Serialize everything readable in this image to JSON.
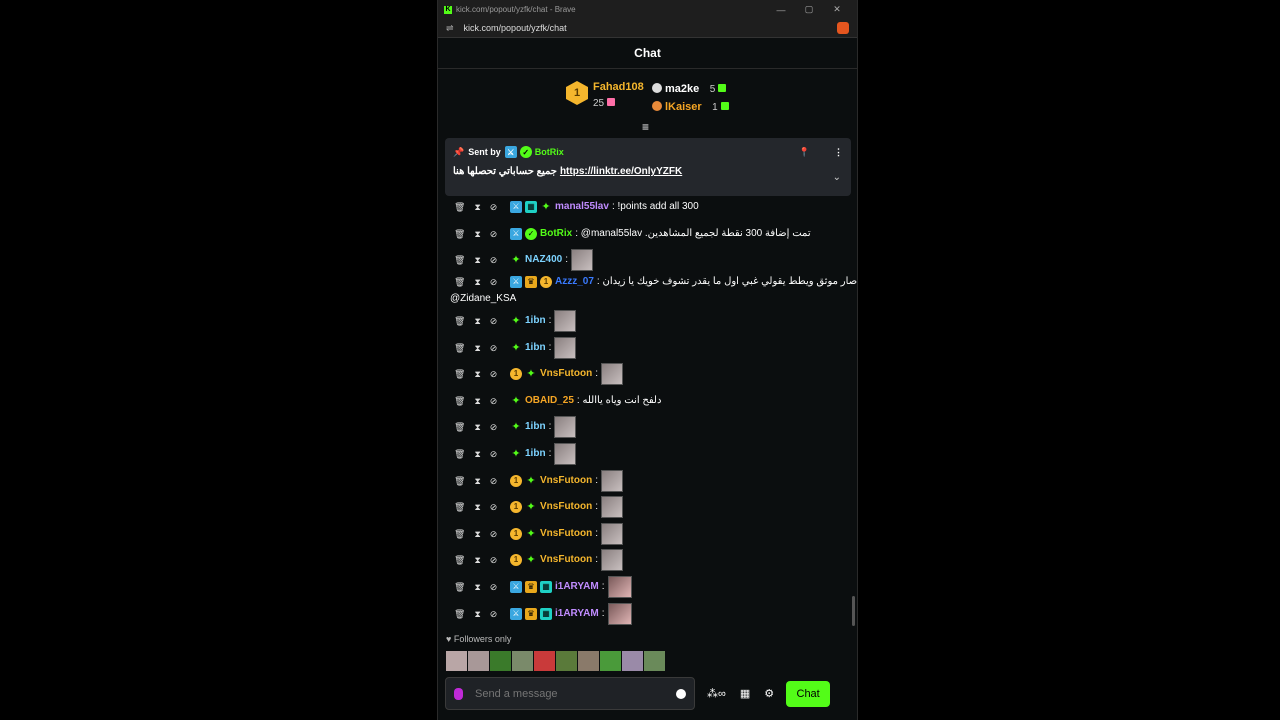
{
  "browser": {
    "title": "kick.com/popout/yzfk/chat - Brave",
    "url": "kick.com/popout/yzfk/chat",
    "controls": [
      "—",
      "▢",
      "✕"
    ]
  },
  "header": {
    "title": "Chat"
  },
  "leaderboard": {
    "first": {
      "rank": "1",
      "name": "Fahad108",
      "count": "25"
    },
    "second": {
      "name": "ma2ke",
      "count": "5"
    },
    "third": {
      "name": "lKaiser",
      "count": "1"
    }
  },
  "pinned": {
    "sent_by": "Sent by",
    "user": "BotRix",
    "text": "جميع حساباتي تحصلها هنا",
    "link": "https://linktr.ee/OnlyYZFK"
  },
  "messages": [
    {
      "user": "manal55lav",
      "color": "#c08cff",
      "badges": [
        "mod",
        "og",
        "sub"
      ],
      "text": ": !points add all 300",
      "emote": ""
    },
    {
      "user": "BotRix",
      "color": "#53fc18",
      "badges": [
        "mod",
        "verified"
      ],
      "text": ": @manal55lav .تمت إضافة 300 نقطة لجميع المشاهدين",
      "emote": ""
    },
    {
      "user": "NAZ400",
      "color": "#7dd3ff",
      "badges": [
        "sub"
      ],
      "text": ":",
      "emote": "gray"
    },
    {
      "user": "Azzz_07",
      "color": "#3a7bff",
      "badges": [
        "mod",
        "vip",
        "gifter"
      ],
      "text": ": صار موثق ويطط يقولي غبي اول ما يقدر تشوف خويك يا زيدان",
      "text2": "@Zidane_KSA",
      "emote": ""
    },
    {
      "user": "1ibn",
      "color": "#7dd3ff",
      "badges": [
        "sub"
      ],
      "text": ":",
      "emote": "gray"
    },
    {
      "user": "1ibn",
      "color": "#7dd3ff",
      "badges": [
        "sub"
      ],
      "text": ":",
      "emote": "gray"
    },
    {
      "user": "VnsFutoon",
      "color": "#f5b62d",
      "badges": [
        "gifter",
        "sub"
      ],
      "text": ":",
      "emote": "gray"
    },
    {
      "user": "OBAID_25",
      "color": "#f5a524",
      "badges": [
        "sub"
      ],
      "text": ": دلفح انت وياه ياالله",
      "emote": ""
    },
    {
      "user": "1ibn",
      "color": "#7dd3ff",
      "badges": [
        "sub"
      ],
      "text": ":",
      "emote": "gray"
    },
    {
      "user": "1ibn",
      "color": "#7dd3ff",
      "badges": [
        "sub"
      ],
      "text": ":",
      "emote": "gray"
    },
    {
      "user": "VnsFutoon",
      "color": "#f5b62d",
      "badges": [
        "gifter",
        "sub"
      ],
      "text": ":",
      "emote": "gray"
    },
    {
      "user": "VnsFutoon",
      "color": "#f5b62d",
      "badges": [
        "gifter",
        "sub"
      ],
      "text": ":",
      "emote": "gray"
    },
    {
      "user": "VnsFutoon",
      "color": "#f5b62d",
      "badges": [
        "gifter",
        "sub"
      ],
      "text": ":",
      "emote": "gray"
    },
    {
      "user": "VnsFutoon",
      "color": "#f5b62d",
      "badges": [
        "gifter",
        "sub"
      ],
      "text": ":",
      "emote": "gray"
    },
    {
      "user": "i1ARYAM",
      "color": "#c08cff",
      "badges": [
        "mod",
        "vip",
        "og"
      ],
      "text": ":",
      "emote": "pink"
    },
    {
      "user": "i1ARYAM",
      "color": "#c08cff",
      "badges": [
        "mod",
        "vip",
        "og"
      ],
      "text": ":",
      "emote": "pink"
    }
  ],
  "footer": {
    "followers_only": "Followers only",
    "placeholder": "Send a message",
    "chat_button": "Chat"
  },
  "colors": {
    "accent": "#53fc18",
    "background": "#0b0e0f"
  }
}
